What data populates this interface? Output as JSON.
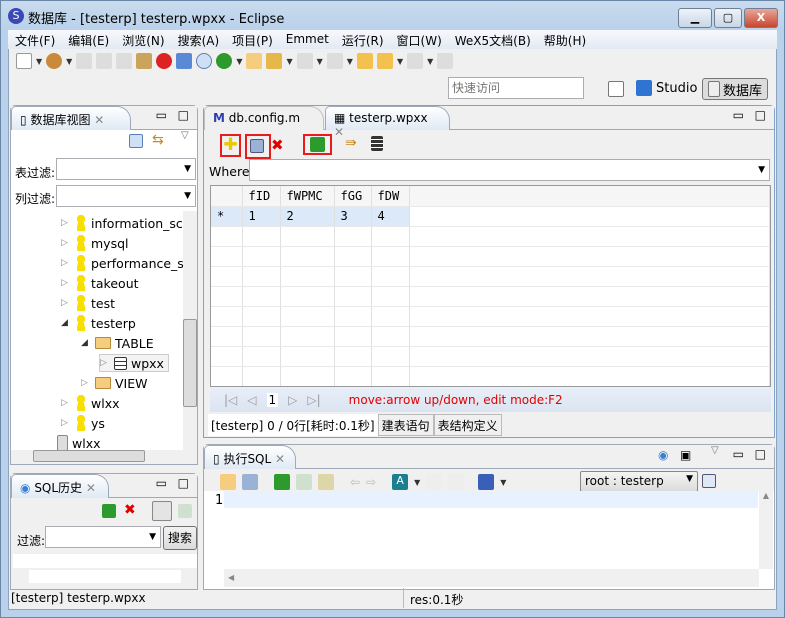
{
  "window": {
    "title": "数据库 - [testerp] testerp.wpxx - Eclipse",
    "controls": [
      "minimize",
      "maximize",
      "close"
    ]
  },
  "menu": [
    "文件(F)",
    "编辑(E)",
    "浏览(N)",
    "搜索(A)",
    "项目(P)",
    "Emmet",
    "运行(R)",
    "窗口(W)",
    "WeX5文档(B)",
    "帮助(H)"
  ],
  "quick_access": {
    "placeholder": "快速访问"
  },
  "perspectives": {
    "studio": "Studio",
    "database": "数据库"
  },
  "db_view": {
    "title": "数据库视图",
    "table_filter_label": "表过滤:",
    "column_filter_label": "列过滤:",
    "tree": [
      "information_scl",
      "mysql",
      "performance_s",
      "takeout",
      "test",
      "testerp",
      "TABLE",
      "wpxx",
      "VIEW",
      "wlxx",
      "ys",
      "wlxx"
    ]
  },
  "sql_history": {
    "title": "SQL历史",
    "filter_label": "过滤:",
    "search_button": "搜索"
  },
  "editor": {
    "tabs": [
      "db.config.m",
      "testerp.wpxx"
    ],
    "where_label": "Where:",
    "columns": [
      "",
      "fID",
      "fWPMC",
      "fGG",
      "fDW"
    ],
    "rows": [
      [
        "*",
        "1",
        "2",
        "3",
        "4"
      ]
    ],
    "page": "1",
    "hint": "move:arrow up/down, edit mode:F2",
    "bottom_tabs": [
      "[testerp] 0 / 0行[耗时:0.1秒]",
      "建表语句",
      "表结构定义"
    ]
  },
  "sql_panel": {
    "title": "执行SQL",
    "connection": "root : testerp",
    "line_number": "1"
  },
  "status": {
    "left": "[testerp] testerp.wpxx",
    "right": "res:0.1秒"
  },
  "colors": {
    "highlight_box": "#e81c1c",
    "hint_text": "#ff0000",
    "selected_row": "#dce9f8"
  }
}
